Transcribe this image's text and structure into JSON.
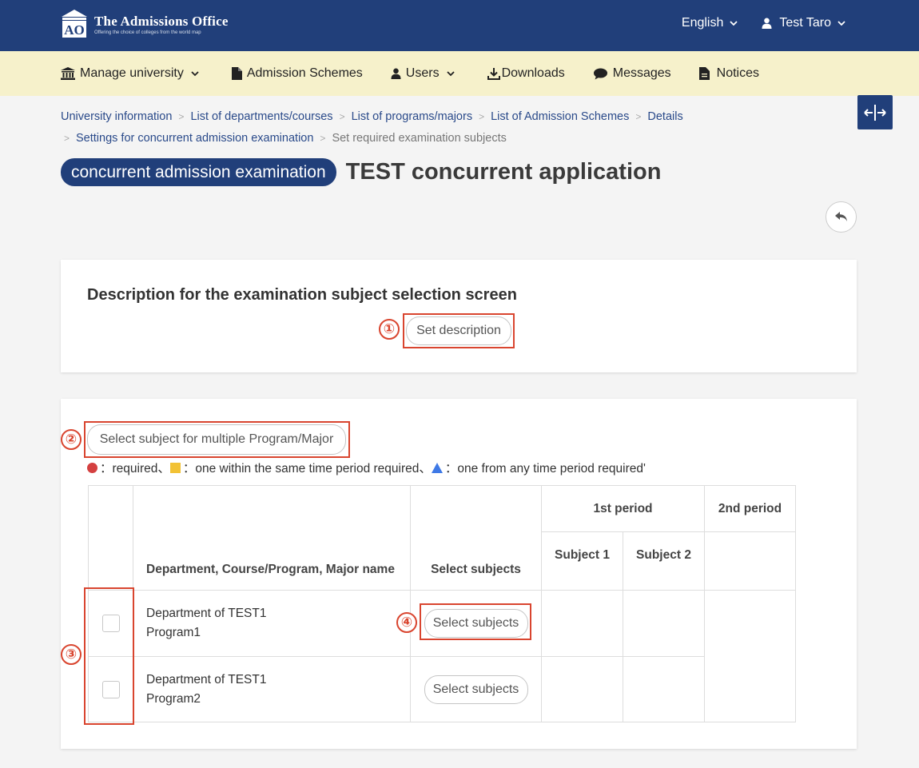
{
  "header": {
    "logo_title": "The Admissions Office",
    "logo_tagline": "Offering the choice of colleges from the world map",
    "logo_mark_text": "AO",
    "language": "English",
    "user": "Test Taro"
  },
  "nav": {
    "items": [
      {
        "label": "Manage university",
        "icon": "university-icon",
        "dropdown": true
      },
      {
        "label": "Admission Schemes",
        "icon": "document-icon",
        "dropdown": false
      },
      {
        "label": "Users",
        "icon": "user-icon",
        "dropdown": true
      },
      {
        "label": "Downloads",
        "icon": "download-icon",
        "dropdown": false
      },
      {
        "label": "Messages",
        "icon": "chat-icon",
        "dropdown": false
      },
      {
        "label": "Notices",
        "icon": "notice-icon",
        "dropdown": false
      }
    ]
  },
  "breadcrumb": {
    "items": [
      "University information",
      "List of departments/courses",
      "List of programs/majors",
      "List of Admission Schemes",
      "Details",
      "Settings for concurrent admission examination"
    ],
    "current": "Set required examination subjects",
    "separator": ">"
  },
  "page": {
    "badge": "concurrent admission examination",
    "title": "TEST concurrent application"
  },
  "description_card": {
    "title": "Description for the examination subject selection screen",
    "button": "Set description"
  },
  "subjects_card": {
    "multi_select_button": "Select subject for multiple Program/Major",
    "legend": {
      "required": "：required、",
      "same_period": "：one within the same time period required、",
      "any_period": "：one from any time period required'"
    },
    "table": {
      "headers": {
        "name": "Department, Course/Program, Major name",
        "select": "Select subjects",
        "period1": "1st period",
        "period2": "2nd period",
        "subject1": "Subject 1",
        "subject2": "Subject 2"
      },
      "rows": [
        {
          "department": "Department of TEST1",
          "program": "Program1",
          "button": "Select subjects"
        },
        {
          "department": "Department of TEST1",
          "program": "Program2",
          "button": "Select subjects"
        }
      ]
    }
  },
  "annotations": [
    "①",
    "②",
    "③",
    "④"
  ],
  "colors": {
    "primary": "#213f7a",
    "nav_bg": "#f6f1cb",
    "highlight": "#d9452f",
    "required": "#d44040",
    "same_period": "#f2c235",
    "any_period": "#3f79e6"
  }
}
